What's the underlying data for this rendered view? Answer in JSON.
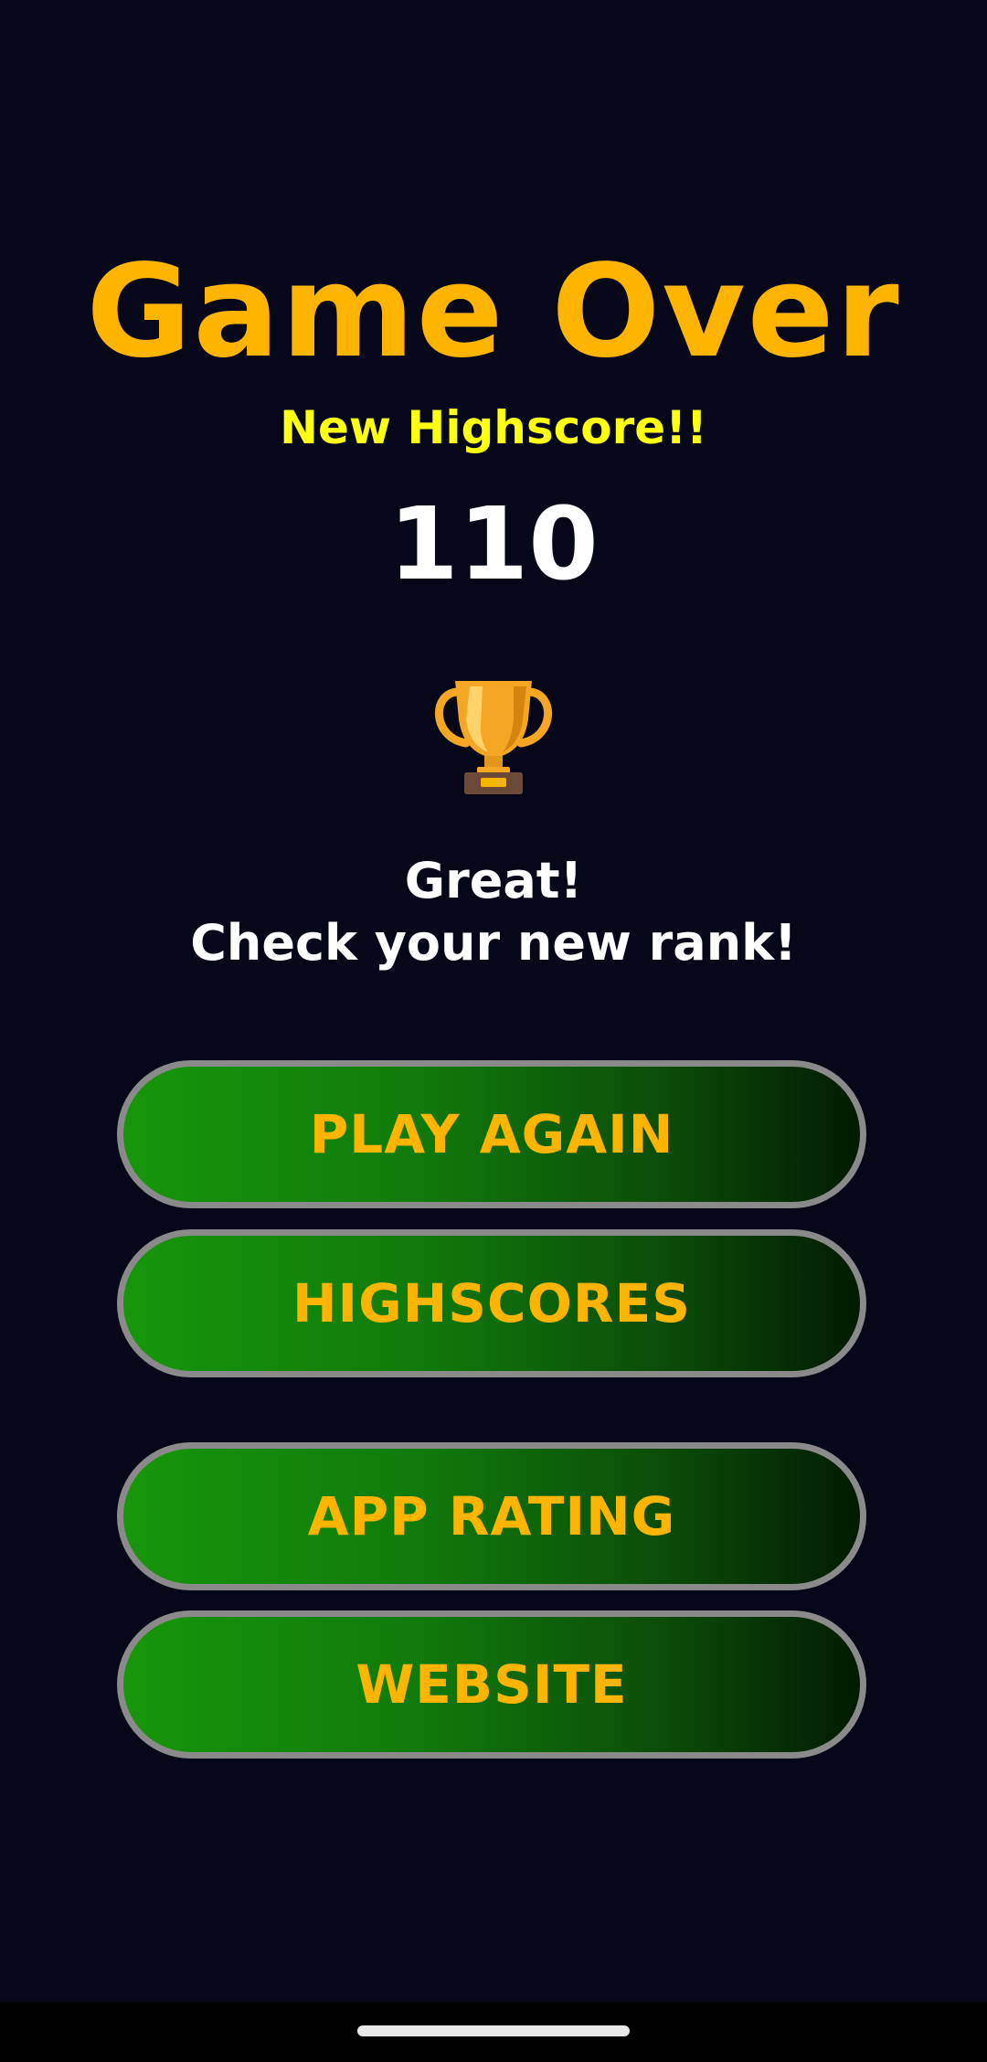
{
  "game": {
    "title": "Game Over",
    "subtitle": "New Highscore!!",
    "score": "110",
    "trophy_icon": "trophy-icon",
    "message_line1": "Great!",
    "message_line2": "Check your new rank!"
  },
  "buttons": {
    "play_again": "PLAY AGAIN",
    "highscores": "HIGHSCORES",
    "app_rating": "APP RATING",
    "website": "WEBSITE"
  },
  "colors": {
    "background": "#06081a",
    "title": "#ffb400",
    "subtitle": "#ffff10",
    "button_text": "#ffb400",
    "button_green": "#16960a",
    "button_border": "#8a8a8a"
  }
}
